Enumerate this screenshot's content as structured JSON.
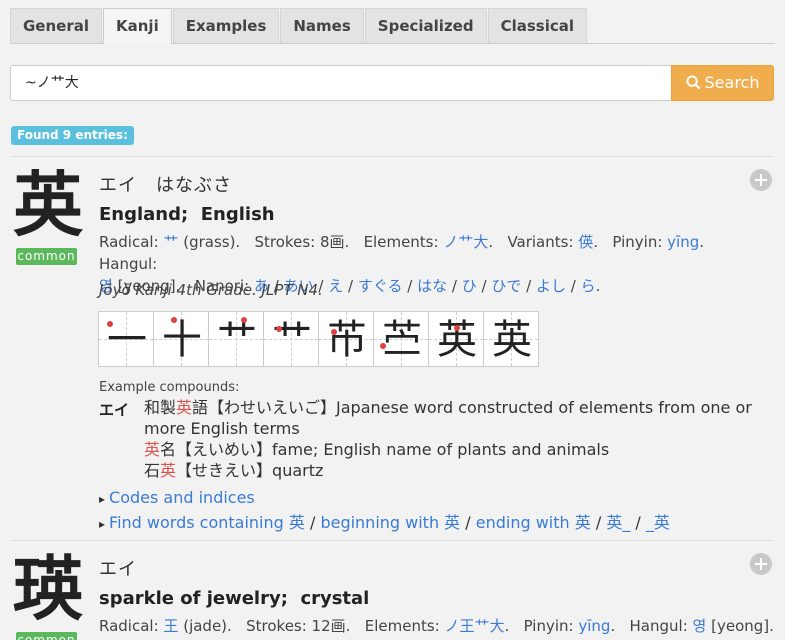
{
  "tabs": [
    "General",
    "Kanji",
    "Examples",
    "Names",
    "Specialized",
    "Classical"
  ],
  "active_tab": "Kanji",
  "search": {
    "value": "~ノ艹大",
    "button_label": "Search"
  },
  "found_label": "Found 9 entries:",
  "entries": [
    {
      "kanji": "英",
      "badge": "common",
      "readings": "エイ　はなぶさ",
      "meanings": [
        "England",
        "English"
      ],
      "radical_label": "Radical:",
      "radical_char": "艹",
      "radical_name": "(grass).",
      "strokes": "Strokes: 8画.",
      "elements_label": "Elements:",
      "elements": "ノ艹大",
      "variants_label": "Variants:",
      "variants": "偀",
      "pinyin_label": "Pinyin:",
      "pinyin": "yīng",
      "hangul_label": "Hangul:",
      "hangul": "영",
      "hangul_rom": "[yeong].",
      "nanori_label": "Nanori:",
      "nanori": [
        "あ",
        "あい",
        "え",
        "すぐる",
        "はな",
        "ひ",
        "ひで",
        "よし",
        "ら"
      ],
      "grade": "Jōyō Kanji 4th Grade.   JLPT N4.",
      "stroke_chars": [
        "一",
        "十",
        "艹",
        "艹",
        "芇",
        "苎",
        "英",
        "英"
      ],
      "examples_title": "Example compounds:",
      "compound_reading": "エイ",
      "compounds": [
        {
          "pre": "和製",
          "hl": "英",
          "post": "語【わせいえいご】Japanese word constructed of elements from one or"
        },
        {
          "pre": "",
          "hl": "",
          "post": "more English terms"
        },
        {
          "pre": "",
          "hl": "英",
          "post": "名【えいめい】fame; English name of plants and animals"
        },
        {
          "pre": "石",
          "hl": "英",
          "post": "【せきえい】quartz"
        }
      ],
      "codes_link": "Codes and indices",
      "find_link": "Find words containing 英",
      "beginning_link": "beginning with 英",
      "ending_link": "ending with 英",
      "prefix_link": "英_",
      "suffix_link": "_英"
    },
    {
      "kanji": "瑛",
      "badge": "common",
      "readings": "エイ",
      "meanings": [
        "sparkle of jewelry",
        "crystal"
      ],
      "radical_label": "Radical:",
      "radical_char": "王",
      "radical_name": "(jade).",
      "strokes": "Strokes: 12画.",
      "elements_label": "Elements:",
      "elements": "ノ王艹大",
      "pinyin_label": "Pinyin:",
      "pinyin": "yīng",
      "hangul_label": "Hangul:",
      "hangul": "영",
      "hangul_rom": "[yeong]."
    }
  ],
  "colors": {
    "accent": "#f0ad4e",
    "link": "#3a7bd5",
    "badge": "#5cb85c",
    "found": "#5bc0de",
    "highlight": "#d9534f"
  },
  "icons": {
    "search": "search-icon",
    "add": "plus-circle-icon"
  }
}
